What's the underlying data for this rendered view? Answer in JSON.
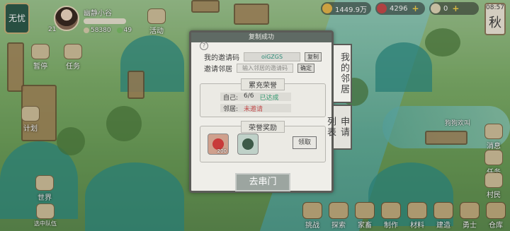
{
  "player": {
    "rank": "无忧",
    "level": "21",
    "name": "幽静小谷",
    "stat1": "58380",
    "stat2": "49"
  },
  "resources": {
    "coins": "1449.9万",
    "gems": "4296",
    "tickets": "0"
  },
  "clock": {
    "time": "08:57",
    "season": "秋"
  },
  "left_menu": {
    "notice": "暂停",
    "event": "活动",
    "task": "任务",
    "plan": "计划",
    "world": "世界",
    "companion": "选中队伍"
  },
  "dialog": {
    "title": "复制成功",
    "help": "?",
    "my_code_label": "我的邀请码",
    "my_code": "oiGZGS",
    "copy_button": "复制",
    "invite_label": "邀请邻居",
    "invite_placeholder": "输入邻居的邀请码",
    "confirm_button": "确定",
    "honor_title": "累充荣誉",
    "self_label": "自己:",
    "self_value": "6/6",
    "self_status": "已达成",
    "neighbor_label": "邻居:",
    "neighbor_status": "未邀请",
    "rewards_title": "荣誉奖励",
    "reward1_count": "200",
    "claim_button": "领取",
    "visit_button": "去串门"
  },
  "side_tabs": {
    "tab1": "我的邻居",
    "tab2": "申请列表"
  },
  "npc": {
    "name": "狗狗欢叫"
  },
  "right_menu": {
    "menu1": "消息",
    "menu2": "任务",
    "menu3": "村民"
  },
  "bottom_menu": [
    "挑战",
    "探索",
    "家畜",
    "制作",
    "材料",
    "建造",
    "勇士",
    "仓库"
  ]
}
